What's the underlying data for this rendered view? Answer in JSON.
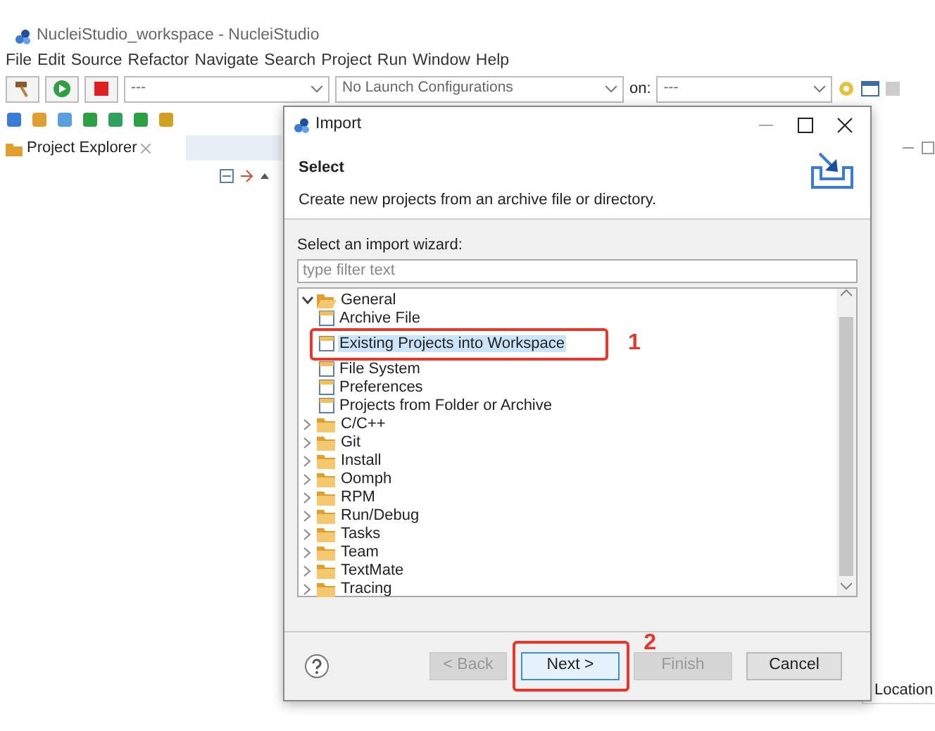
{
  "ide": {
    "title": "NucleiStudio_workspace - NucleiStudio",
    "menu": [
      "File",
      "Edit",
      "Source",
      "Refactor",
      "Navigate",
      "Search",
      "Project",
      "Run",
      "Window",
      "Help"
    ],
    "build_combo": "---",
    "launch_combo": "No Launch Configurations",
    "target_label": "on:",
    "target_combo": "---",
    "view_tab": "Project Explorer",
    "table_column": "Location"
  },
  "dialog": {
    "title": "Import",
    "heading": "Select",
    "description": "Create new projects from an archive file or directory.",
    "prompt": "Select an import wizard:",
    "filter": {
      "placeholder": "type filter text"
    },
    "tree": [
      {
        "label": "General",
        "expanded": true,
        "selected": false,
        "children": [
          {
            "label": "Archive File",
            "selected": false
          },
          {
            "label": "Existing Projects into Workspace",
            "selected": true,
            "annotation": "1"
          },
          {
            "label": "File System",
            "selected": false
          },
          {
            "label": "Preferences",
            "selected": false
          },
          {
            "label": "Projects from Folder or Archive",
            "selected": false
          }
        ]
      },
      {
        "label": "C/C++",
        "expanded": false,
        "selected": false
      },
      {
        "label": "Git",
        "expanded": false,
        "selected": false
      },
      {
        "label": "Install",
        "expanded": false,
        "selected": false
      },
      {
        "label": "Oomph",
        "expanded": false,
        "selected": false
      },
      {
        "label": "RPM",
        "expanded": false,
        "selected": false
      },
      {
        "label": "Run/Debug",
        "expanded": false,
        "selected": false
      },
      {
        "label": "Tasks",
        "expanded": false,
        "selected": false
      },
      {
        "label": "Team",
        "expanded": false,
        "selected": false
      },
      {
        "label": "TextMate",
        "expanded": false,
        "selected": false
      },
      {
        "label": "Tracing",
        "expanded": false,
        "selected": false
      }
    ],
    "buttons": [
      {
        "label": "< Back",
        "disabled": true,
        "default": false
      },
      {
        "label": "Next >",
        "disabled": false,
        "default": true,
        "annotation": "2"
      },
      {
        "label": "Finish",
        "disabled": true,
        "default": false
      },
      {
        "label": "Cancel",
        "disabled": false,
        "default": false
      }
    ]
  }
}
